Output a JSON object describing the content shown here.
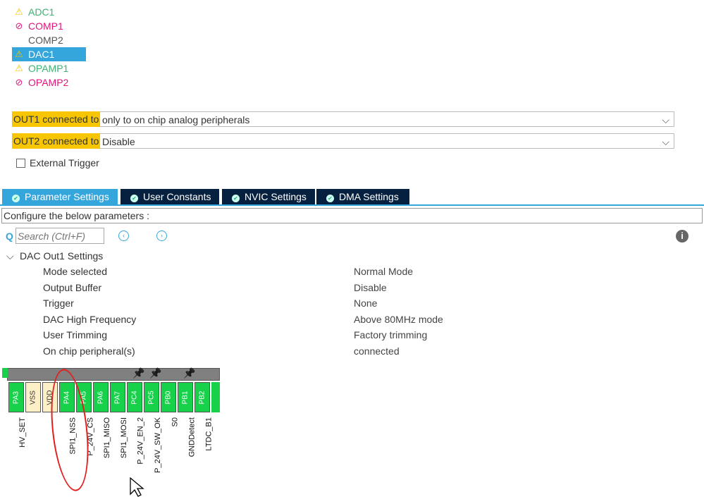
{
  "peripherals": [
    {
      "name": "ADC1",
      "status": "warning",
      "color": "#3cb371"
    },
    {
      "name": "COMP1",
      "status": "disabled",
      "color": "#e0157a"
    },
    {
      "name": "COMP2",
      "status": "none",
      "color": "#555555"
    },
    {
      "name": "DAC1",
      "status": "warning",
      "color": "#ffffff",
      "selected": true
    },
    {
      "name": "OPAMP1",
      "status": "warning",
      "color": "#3cb371"
    },
    {
      "name": "OPAMP2",
      "status": "disabled",
      "color": "#e0157a"
    }
  ],
  "icons": {
    "warning": "⚠",
    "disabled": "⊘"
  },
  "out1": {
    "label": "OUT1 connected to",
    "value": "only to on chip analog peripherals"
  },
  "out2": {
    "label": "OUT2 connected to",
    "value": "Disable"
  },
  "external_trigger": {
    "label": "External Trigger",
    "checked": false
  },
  "tabs": [
    "Parameter Settings",
    "User Constants",
    "NVIC Settings",
    "DMA Settings"
  ],
  "configure_text": "Configure the below parameters :",
  "search_placeholder": "Search (Ctrl+F)",
  "group": "DAC Out1 Settings",
  "params": [
    {
      "name": "Mode selected",
      "value": "Normal Mode"
    },
    {
      "name": "Output Buffer",
      "value": "Disable"
    },
    {
      "name": "Trigger",
      "value": "None"
    },
    {
      "name": "DAC High Frequency",
      "value": "Above 80MHz mode"
    },
    {
      "name": "User Trimming",
      "value": "Factory trimming"
    },
    {
      "name": "On chip peripheral(s)",
      "value": "connected"
    }
  ],
  "pins": [
    {
      "pin": "PA3",
      "label": "HV_SET"
    },
    {
      "pin": "VSS",
      "label": ""
    },
    {
      "pin": "VDD",
      "label": ""
    },
    {
      "pin": "PA4",
      "label": "SPI1_NSS"
    },
    {
      "pin": "PA5",
      "label": "P_24V_CS"
    },
    {
      "pin": "PA6",
      "label": "SPI1_MISO"
    },
    {
      "pin": "PA7",
      "label": "SPI1_MOSI"
    },
    {
      "pin": "PC4",
      "label": "P_24V_EN_2",
      "pinned": true
    },
    {
      "pin": "PC5",
      "label": "P_24V_SW_OK",
      "pinned": true
    },
    {
      "pin": "PB0",
      "label": "S0"
    },
    {
      "pin": "PB1",
      "label": "GNDDetect",
      "pinned": true
    },
    {
      "pin": "PB2",
      "label": "LTDC_B1"
    }
  ]
}
